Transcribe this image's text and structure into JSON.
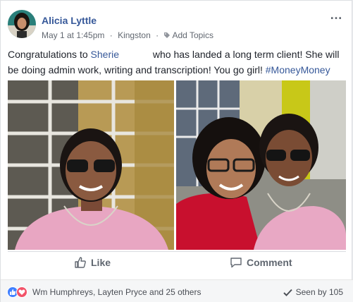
{
  "post": {
    "author": "Alicia Lyttle",
    "date": "May 1 at 1:45pm",
    "location": "Kingston",
    "add_topics": "Add Topics",
    "more_icon": "…",
    "text_pre": "Congratulations to ",
    "mention": "Sherie",
    "text_post": " who has landed a long term client! She will be doing admin work, writing and transcription! You go girl! ",
    "hashtag": "#MoneyMoney"
  },
  "actions": {
    "like_label": "Like",
    "comment_label": "Comment"
  },
  "footer": {
    "reactors": "Wm Humphreys, Layten Pryce and 25 others",
    "seen": "Seen by 105"
  },
  "colors": {
    "link": "#365899",
    "like_reaction": "#4080ff",
    "love_reaction": "#f25268"
  },
  "icons": [
    "avatar",
    "more-options-icon",
    "tag-icon",
    "like-icon",
    "comment-icon",
    "like-reaction-icon",
    "love-reaction-icon",
    "checkmark-icon"
  ]
}
